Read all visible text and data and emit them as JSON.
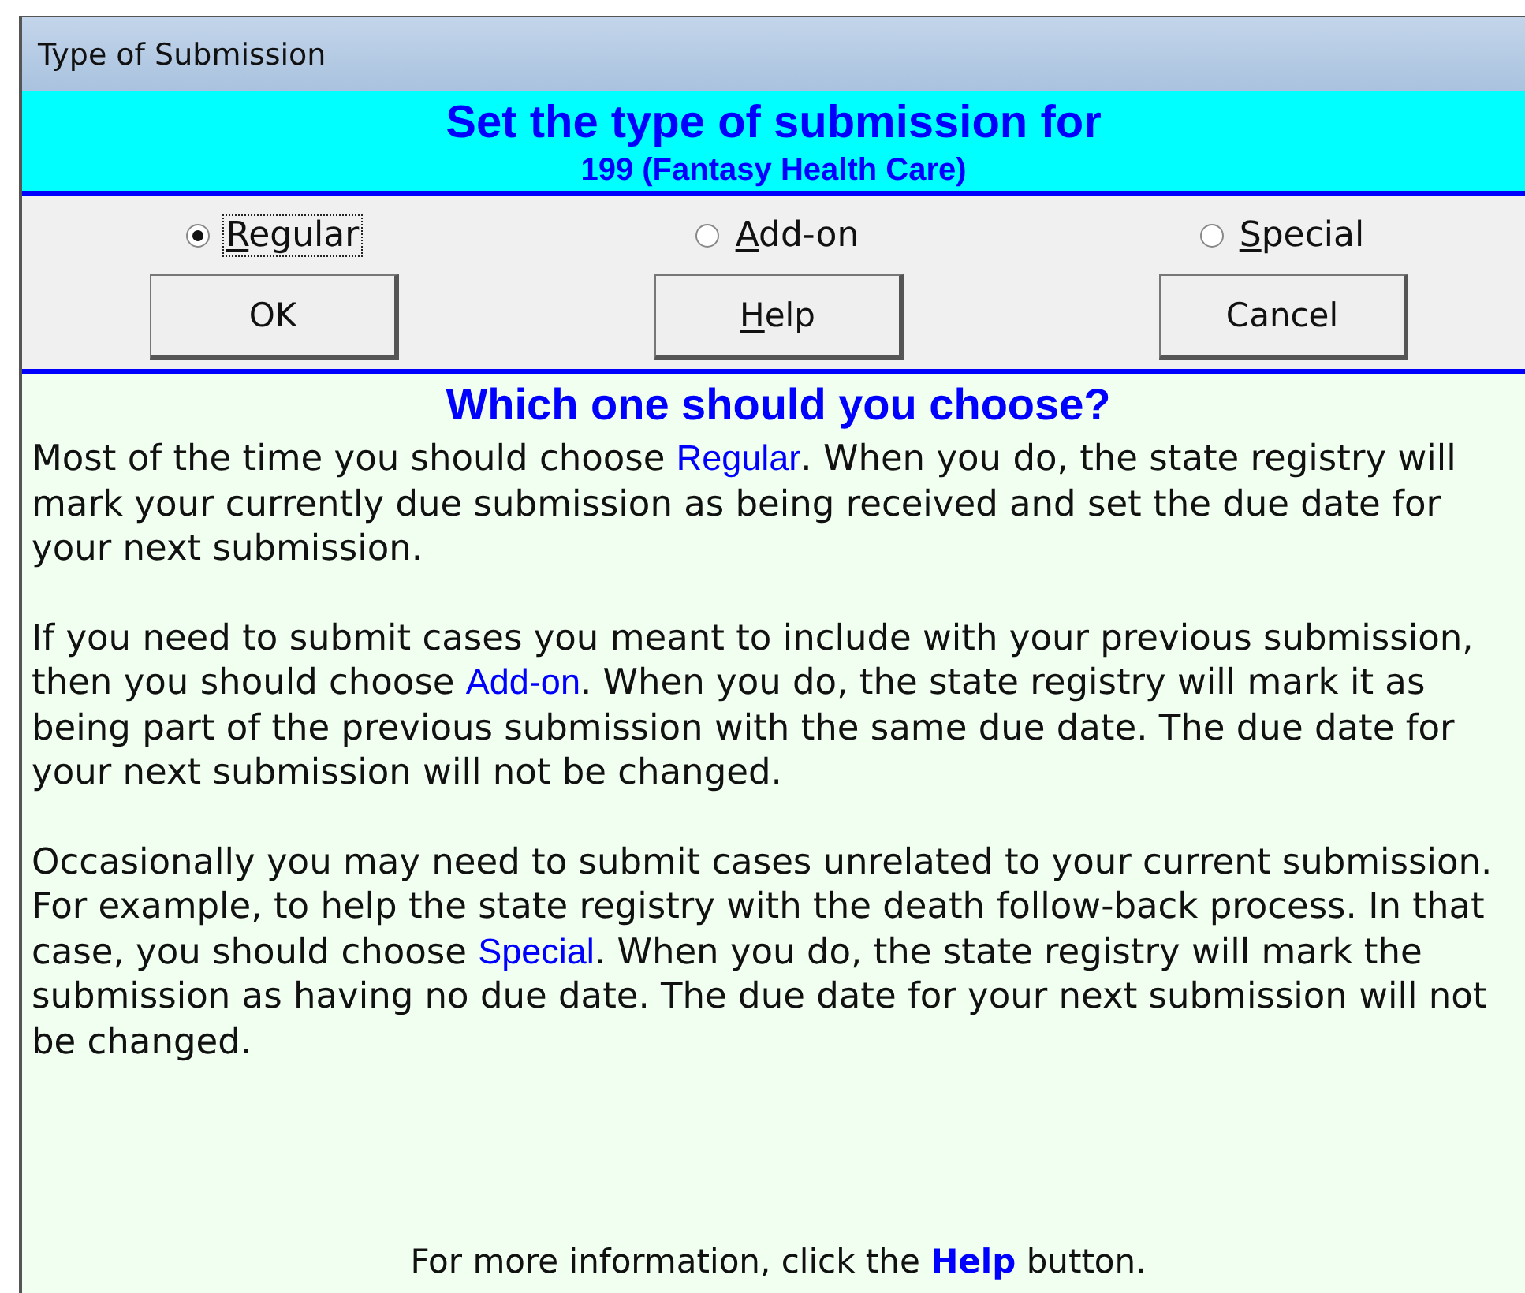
{
  "window": {
    "title": "Type of Submission"
  },
  "header": {
    "title": "Set the type of submission for",
    "subtitle": "199 (Fantasy Health Care)"
  },
  "options": [
    {
      "label": "Regular",
      "selected": true,
      "mnemonic": true
    },
    {
      "label": "Add-on",
      "selected": false,
      "mnemonic": true
    },
    {
      "label": "Special",
      "selected": false,
      "mnemonic": true
    }
  ],
  "buttons": [
    {
      "label": "OK",
      "mnemonic": false
    },
    {
      "label": "Help",
      "mnemonic": true
    },
    {
      "label": "Cancel",
      "mnemonic": false
    }
  ],
  "help": {
    "heading": "Which one should you choose?",
    "paragraphs": [
      "Most of the time you should choose **Regular**. When you do, the state registry will mark your currently due submission as being received and set the due date for your next submission.",
      "If you need to submit cases you meant to include with your previous submission, then you should choose **Add-on**. When you do, the state registry will mark it as being part of the previous submission with the same due date. The due date for your next submission will not be changed.",
      "Occasionally you may need to submit cases unrelated to your current submission. For example, to help the state registry with the death follow-back process. In that case, you should choose **Special**. When you do, the state registry will mark the submission as having no due date. The due date for your next submission will not be changed."
    ],
    "footer": "For more information, click the **Help** button."
  }
}
